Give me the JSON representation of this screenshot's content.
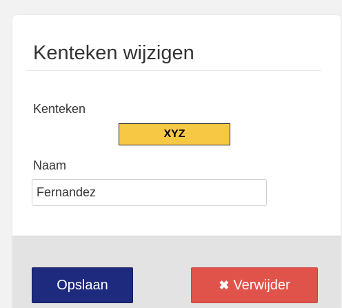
{
  "modal": {
    "title": "Kenteken wijzigen"
  },
  "form": {
    "kenteken_label": "Kenteken",
    "kenteken_value": "XYZ",
    "naam_label": "Naam",
    "naam_value": "Fernandez",
    "naam_placeholder": ""
  },
  "footer": {
    "save_label": "Opslaan",
    "delete_label": "Verwijder",
    "delete_icon": "times-icon"
  },
  "colors": {
    "save_button": "#1d2a7e",
    "delete_button": "#e0534a",
    "plate_background": "#f7c843"
  }
}
